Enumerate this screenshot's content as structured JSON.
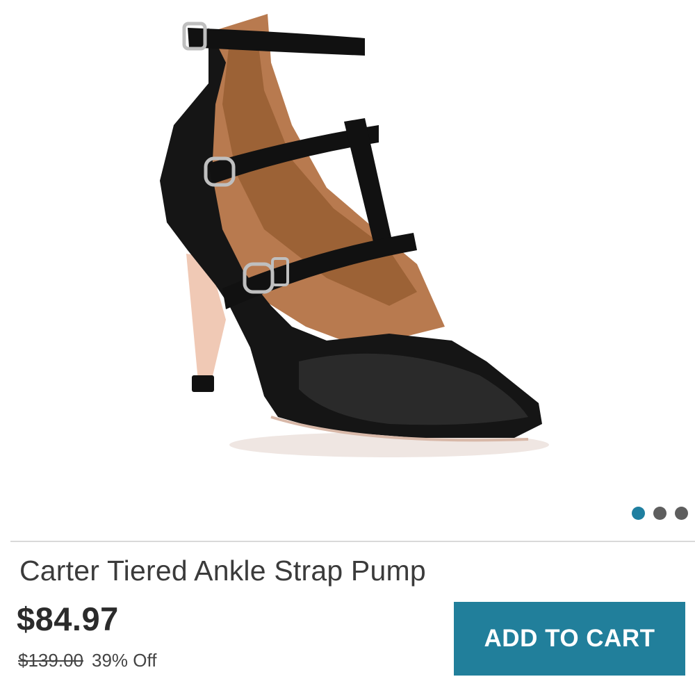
{
  "product": {
    "title": "Carter Tiered Ankle Strap Pump",
    "price": "$84.97",
    "original_price": "$139.00",
    "discount": "39% Off",
    "image_alt": "black tiered ankle strap pointed-toe pump"
  },
  "carousel": {
    "count": 3,
    "active_index": 0
  },
  "actions": {
    "add_to_cart_label": "ADD TO CART"
  },
  "colors": {
    "accent": "#217f9b",
    "active_dot": "#1f7fa0",
    "inactive_dot": "#5e5e5e"
  }
}
